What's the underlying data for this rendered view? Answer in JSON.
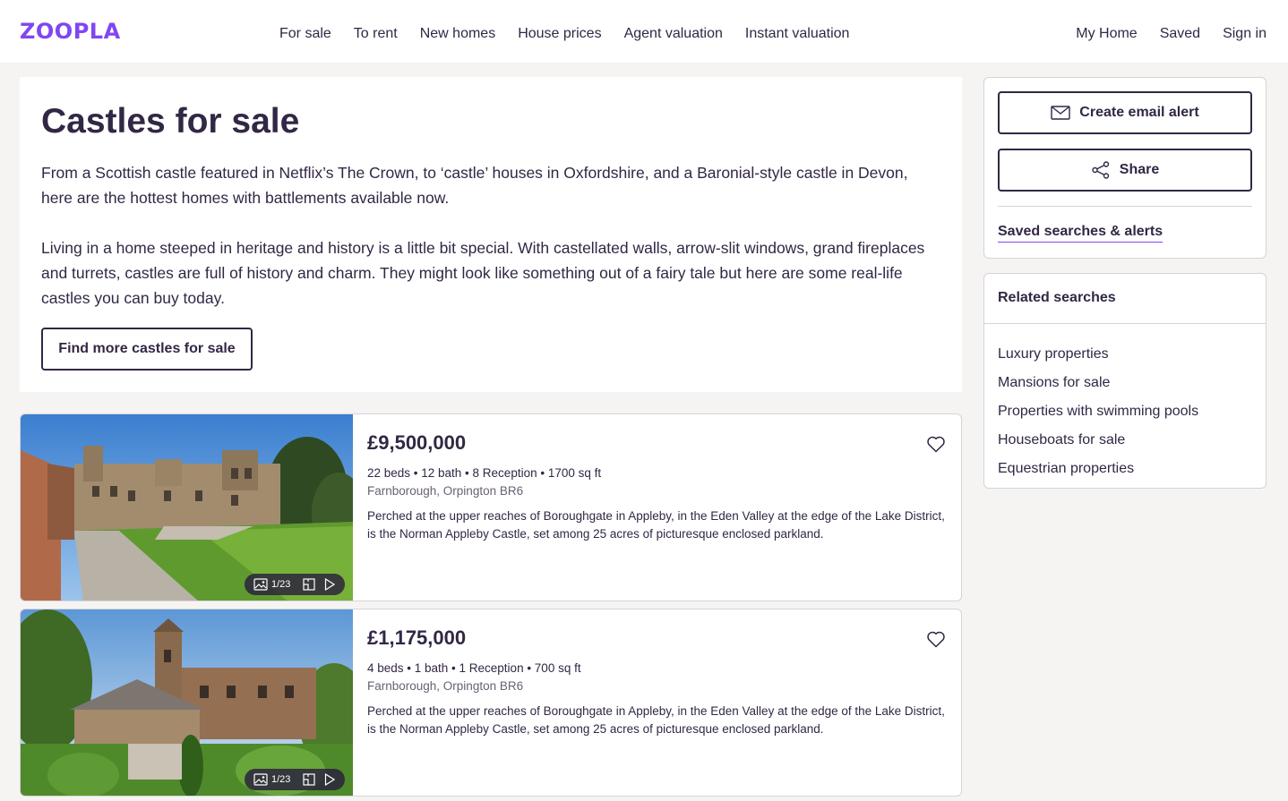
{
  "header": {
    "logo": "ZOOPLA",
    "nav": [
      "For sale",
      "To rent",
      "New homes",
      "House prices",
      "Agent valuation",
      "Instant valuation"
    ],
    "right_nav": [
      "My Home",
      "Saved",
      "Sign in"
    ]
  },
  "intro": {
    "title": "Castles for sale",
    "paragraph1": "From a Scottish castle featured in Netflix’s The Crown, to ‘castle’ houses in Oxfordshire, and a Baronial-style castle in Devon, here are the hottest homes with battlements available now.",
    "paragraph2": "Living in a home steeped in heritage and history is a little bit special. With castellated walls, arrow-slit windows, grand fireplaces and turrets, castles are full of history and charm.  They might look like something out of a fairy tale but here are some real-life castles you can buy today.",
    "button": "Find more castles for sale"
  },
  "listings": [
    {
      "price": "£9,500,000",
      "specs": "22 beds • 12 bath • 8 Reception • 1700 sq ft",
      "address": "Farnborough, Orpington BR6",
      "description": "Perched at the upper reaches of Boroughgate in Appleby, in the Eden Valley at the edge of the Lake District, is the Norman Appleby Castle, set among 25 acres of picturesque enclosed parkland.",
      "photo_count": "1/23"
    },
    {
      "price": "£1,175,000",
      "specs": "4 beds • 1 bath • 1 Reception • 700 sq ft",
      "address": "Farnborough, Orpington BR6",
      "description": "Perched at the upper reaches of Boroughgate in Appleby, in the Eden Valley at the edge of the Lake District, is the Norman Appleby Castle, set among 25 acres of picturesque enclosed parkland.",
      "photo_count": "1/23"
    }
  ],
  "sidebar": {
    "email_alert": "Create email alert",
    "share": "Share",
    "saved_searches": "Saved searches & alerts",
    "related_title": "Related searches",
    "related": [
      "Luxury properties",
      "Mansions for sale",
      "Properties with swimming pools",
      "Houseboats for sale",
      "Equestrian properties"
    ]
  },
  "icons": {
    "email": "envelope-icon",
    "share": "share-icon",
    "save": "heart-icon",
    "photos": "image-icon",
    "floorplan": "floorplan-icon",
    "video": "play-icon"
  },
  "colors": {
    "brand": "#8046f1",
    "text": "#322744",
    "background": "#f5f4f2"
  }
}
